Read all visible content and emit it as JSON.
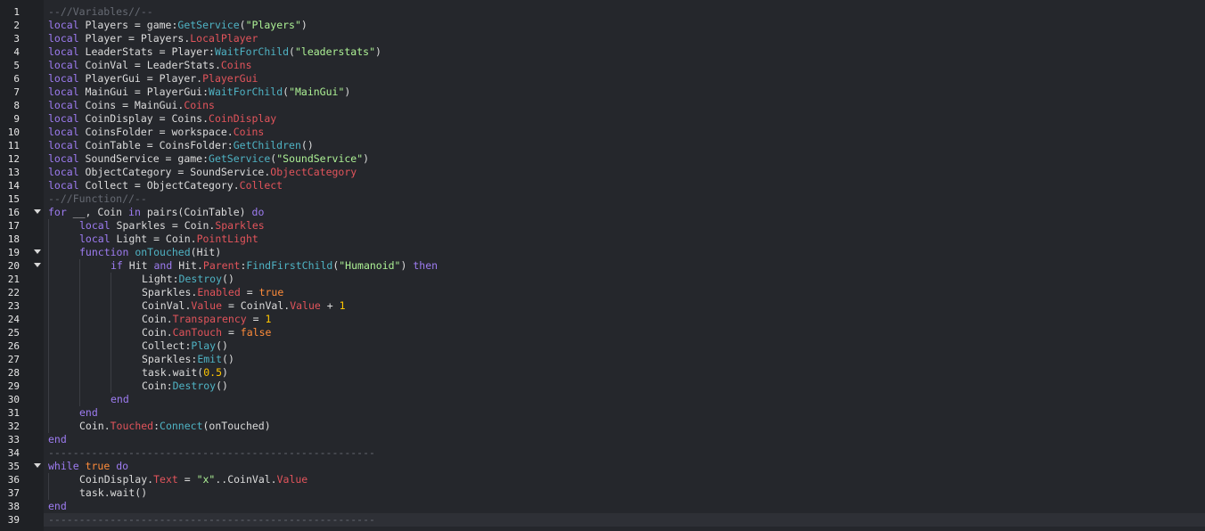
{
  "editor": {
    "theme_colors": {
      "keyword": "#f86d7c",
      "keyword_block": "#9e7cf2",
      "function": "#4fb3c4",
      "property": "#e2545b",
      "string": "#adf195",
      "number": "#ffc600",
      "boolean": "#ff8c3a",
      "comment": "#666a73",
      "identifier": "#dcdcdc",
      "background": "#25272c",
      "gutter": "#1f2125"
    },
    "current_line": 39,
    "lines": [
      {
        "n": "1",
        "indent": 0,
        "tokens": [
          [
            "cm",
            "--//Variables//--"
          ]
        ]
      },
      {
        "n": "2",
        "indent": 0,
        "tokens": [
          [
            "kwb",
            "local"
          ],
          [
            "id",
            " Players = game:"
          ],
          [
            "fn",
            "GetService"
          ],
          [
            "id",
            "("
          ],
          [
            "str",
            "\"Players\""
          ],
          [
            "id",
            ")"
          ]
        ]
      },
      {
        "n": "3",
        "indent": 0,
        "tokens": [
          [
            "kwb",
            "local"
          ],
          [
            "id",
            " Player = Players."
          ],
          [
            "prop",
            "LocalPlayer"
          ]
        ]
      },
      {
        "n": "4",
        "indent": 0,
        "tokens": [
          [
            "kwb",
            "local"
          ],
          [
            "id",
            " LeaderStats = Player:"
          ],
          [
            "fn",
            "WaitForChild"
          ],
          [
            "id",
            "("
          ],
          [
            "str",
            "\"leaderstats\""
          ],
          [
            "id",
            ")"
          ]
        ]
      },
      {
        "n": "5",
        "indent": 0,
        "tokens": [
          [
            "kwb",
            "local"
          ],
          [
            "id",
            " CoinVal = LeaderStats."
          ],
          [
            "prop",
            "Coins"
          ]
        ]
      },
      {
        "n": "6",
        "indent": 0,
        "tokens": [
          [
            "kwb",
            "local"
          ],
          [
            "id",
            " PlayerGui = Player."
          ],
          [
            "prop",
            "PlayerGui"
          ]
        ]
      },
      {
        "n": "7",
        "indent": 0,
        "tokens": [
          [
            "kwb",
            "local"
          ],
          [
            "id",
            " MainGui = PlayerGui:"
          ],
          [
            "fn",
            "WaitForChild"
          ],
          [
            "id",
            "("
          ],
          [
            "str",
            "\"MainGui\""
          ],
          [
            "id",
            ")"
          ]
        ]
      },
      {
        "n": "8",
        "indent": 0,
        "tokens": [
          [
            "kwb",
            "local"
          ],
          [
            "id",
            " Coins = MainGui."
          ],
          [
            "prop",
            "Coins"
          ]
        ]
      },
      {
        "n": "9",
        "indent": 0,
        "tokens": [
          [
            "kwb",
            "local"
          ],
          [
            "id",
            " CoinDisplay = Coins."
          ],
          [
            "prop",
            "CoinDisplay"
          ]
        ]
      },
      {
        "n": "10",
        "indent": 0,
        "tokens": [
          [
            "kwb",
            "local"
          ],
          [
            "id",
            " CoinsFolder = workspace."
          ],
          [
            "prop",
            "Coins"
          ]
        ]
      },
      {
        "n": "11",
        "indent": 0,
        "tokens": [
          [
            "kwb",
            "local"
          ],
          [
            "id",
            " CoinTable = CoinsFolder:"
          ],
          [
            "fn",
            "GetChildren"
          ],
          [
            "id",
            "()"
          ]
        ]
      },
      {
        "n": "12",
        "indent": 0,
        "tokens": [
          [
            "kwb",
            "local"
          ],
          [
            "id",
            " SoundService = game:"
          ],
          [
            "fn",
            "GetService"
          ],
          [
            "id",
            "("
          ],
          [
            "str",
            "\"SoundService\""
          ],
          [
            "id",
            ")"
          ]
        ]
      },
      {
        "n": "13",
        "indent": 0,
        "tokens": [
          [
            "kwb",
            "local"
          ],
          [
            "id",
            " ObjectCategory = SoundService."
          ],
          [
            "prop",
            "ObjectCategory"
          ]
        ]
      },
      {
        "n": "14",
        "indent": 0,
        "tokens": [
          [
            "kwb",
            "local"
          ],
          [
            "id",
            " Collect = ObjectCategory."
          ],
          [
            "prop",
            "Collect"
          ]
        ]
      },
      {
        "n": "15",
        "indent": 0,
        "tokens": [
          [
            "cm",
            "--//Function//--"
          ]
        ]
      },
      {
        "n": "16",
        "indent": 0,
        "fold": true,
        "tokens": [
          [
            "kwb",
            "for"
          ],
          [
            "id",
            " __, Coin "
          ],
          [
            "kwb",
            "in"
          ],
          [
            "id",
            " pairs(CoinTable) "
          ],
          [
            "kwb",
            "do"
          ]
        ]
      },
      {
        "n": "17",
        "indent": 1,
        "tokens": [
          [
            "kwb",
            "local"
          ],
          [
            "id",
            " Sparkles = Coin."
          ],
          [
            "prop",
            "Sparkles"
          ]
        ]
      },
      {
        "n": "18",
        "indent": 1,
        "tokens": [
          [
            "kwb",
            "local"
          ],
          [
            "id",
            " Light = Coin."
          ],
          [
            "prop",
            "PointLight"
          ]
        ]
      },
      {
        "n": "19",
        "indent": 1,
        "fold": true,
        "tokens": [
          [
            "kwb",
            "function"
          ],
          [
            "id",
            " "
          ],
          [
            "fn",
            "onTouched"
          ],
          [
            "id",
            "(Hit)"
          ]
        ]
      },
      {
        "n": "20",
        "indent": 2,
        "fold": true,
        "tokens": [
          [
            "kwb",
            "if"
          ],
          [
            "id",
            " Hit "
          ],
          [
            "kwb",
            "and"
          ],
          [
            "id",
            " Hit."
          ],
          [
            "prop",
            "Parent"
          ],
          [
            "id",
            ":"
          ],
          [
            "fn",
            "FindFirstChild"
          ],
          [
            "id",
            "("
          ],
          [
            "str",
            "\"Humanoid\""
          ],
          [
            "id",
            ") "
          ],
          [
            "kwb",
            "then"
          ]
        ]
      },
      {
        "n": "21",
        "indent": 3,
        "tokens": [
          [
            "id",
            "Light:"
          ],
          [
            "fn",
            "Destroy"
          ],
          [
            "id",
            "()"
          ]
        ]
      },
      {
        "n": "22",
        "indent": 3,
        "tokens": [
          [
            "id",
            "Sparkles."
          ],
          [
            "prop",
            "Enabled"
          ],
          [
            "id",
            " = "
          ],
          [
            "bool",
            "true"
          ]
        ]
      },
      {
        "n": "23",
        "indent": 3,
        "tokens": [
          [
            "id",
            "CoinVal."
          ],
          [
            "prop",
            "Value"
          ],
          [
            "id",
            " = CoinVal."
          ],
          [
            "prop",
            "Value"
          ],
          [
            "id",
            " + "
          ],
          [
            "num",
            "1"
          ]
        ]
      },
      {
        "n": "24",
        "indent": 3,
        "tokens": [
          [
            "id",
            "Coin."
          ],
          [
            "prop",
            "Transparency"
          ],
          [
            "id",
            " = "
          ],
          [
            "num",
            "1"
          ]
        ]
      },
      {
        "n": "25",
        "indent": 3,
        "tokens": [
          [
            "id",
            "Coin."
          ],
          [
            "prop",
            "CanTouch"
          ],
          [
            "id",
            " = "
          ],
          [
            "bool",
            "false"
          ]
        ]
      },
      {
        "n": "26",
        "indent": 3,
        "tokens": [
          [
            "id",
            "Collect:"
          ],
          [
            "fn",
            "Play"
          ],
          [
            "id",
            "()"
          ]
        ]
      },
      {
        "n": "27",
        "indent": 3,
        "tokens": [
          [
            "id",
            "Sparkles:"
          ],
          [
            "fn",
            "Emit"
          ],
          [
            "id",
            "()"
          ]
        ]
      },
      {
        "n": "28",
        "indent": 3,
        "tokens": [
          [
            "id",
            "task.wait("
          ],
          [
            "num",
            "0.5"
          ],
          [
            "id",
            ")"
          ]
        ]
      },
      {
        "n": "29",
        "indent": 3,
        "tokens": [
          [
            "id",
            "Coin:"
          ],
          [
            "fn",
            "Destroy"
          ],
          [
            "id",
            "()"
          ]
        ]
      },
      {
        "n": "30",
        "indent": 2,
        "tokens": [
          [
            "kwb",
            "end"
          ]
        ]
      },
      {
        "n": "31",
        "indent": 1,
        "tokens": [
          [
            "kwb",
            "end"
          ]
        ]
      },
      {
        "n": "32",
        "indent": 1,
        "tokens": [
          [
            "id",
            "Coin."
          ],
          [
            "prop",
            "Touched"
          ],
          [
            "id",
            ":"
          ],
          [
            "fn",
            "Connect"
          ],
          [
            "id",
            "(onTouched)"
          ]
        ]
      },
      {
        "n": "33",
        "indent": 0,
        "tokens": [
          [
            "kwb",
            "end"
          ]
        ]
      },
      {
        "n": "34",
        "indent": 0,
        "tokens": [
          [
            "cm",
            "-----------------------------------------------------"
          ]
        ]
      },
      {
        "n": "35",
        "indent": 0,
        "fold": true,
        "tokens": [
          [
            "kwb",
            "while"
          ],
          [
            "id",
            " "
          ],
          [
            "bool",
            "true"
          ],
          [
            "id",
            " "
          ],
          [
            "kwb",
            "do"
          ]
        ]
      },
      {
        "n": "36",
        "indent": 1,
        "tokens": [
          [
            "id",
            "CoinDisplay."
          ],
          [
            "prop",
            "Text"
          ],
          [
            "id",
            " = "
          ],
          [
            "str",
            "\"x\""
          ],
          [
            "id",
            "..CoinVal."
          ],
          [
            "prop",
            "Value"
          ]
        ]
      },
      {
        "n": "37",
        "indent": 1,
        "tokens": [
          [
            "id",
            "task.wait()"
          ]
        ]
      },
      {
        "n": "38",
        "indent": 0,
        "tokens": [
          [
            "kwb",
            "end"
          ]
        ]
      },
      {
        "n": "39",
        "indent": 0,
        "tokens": [
          [
            "cm",
            "-----------------------------------------------------"
          ]
        ]
      }
    ]
  }
}
